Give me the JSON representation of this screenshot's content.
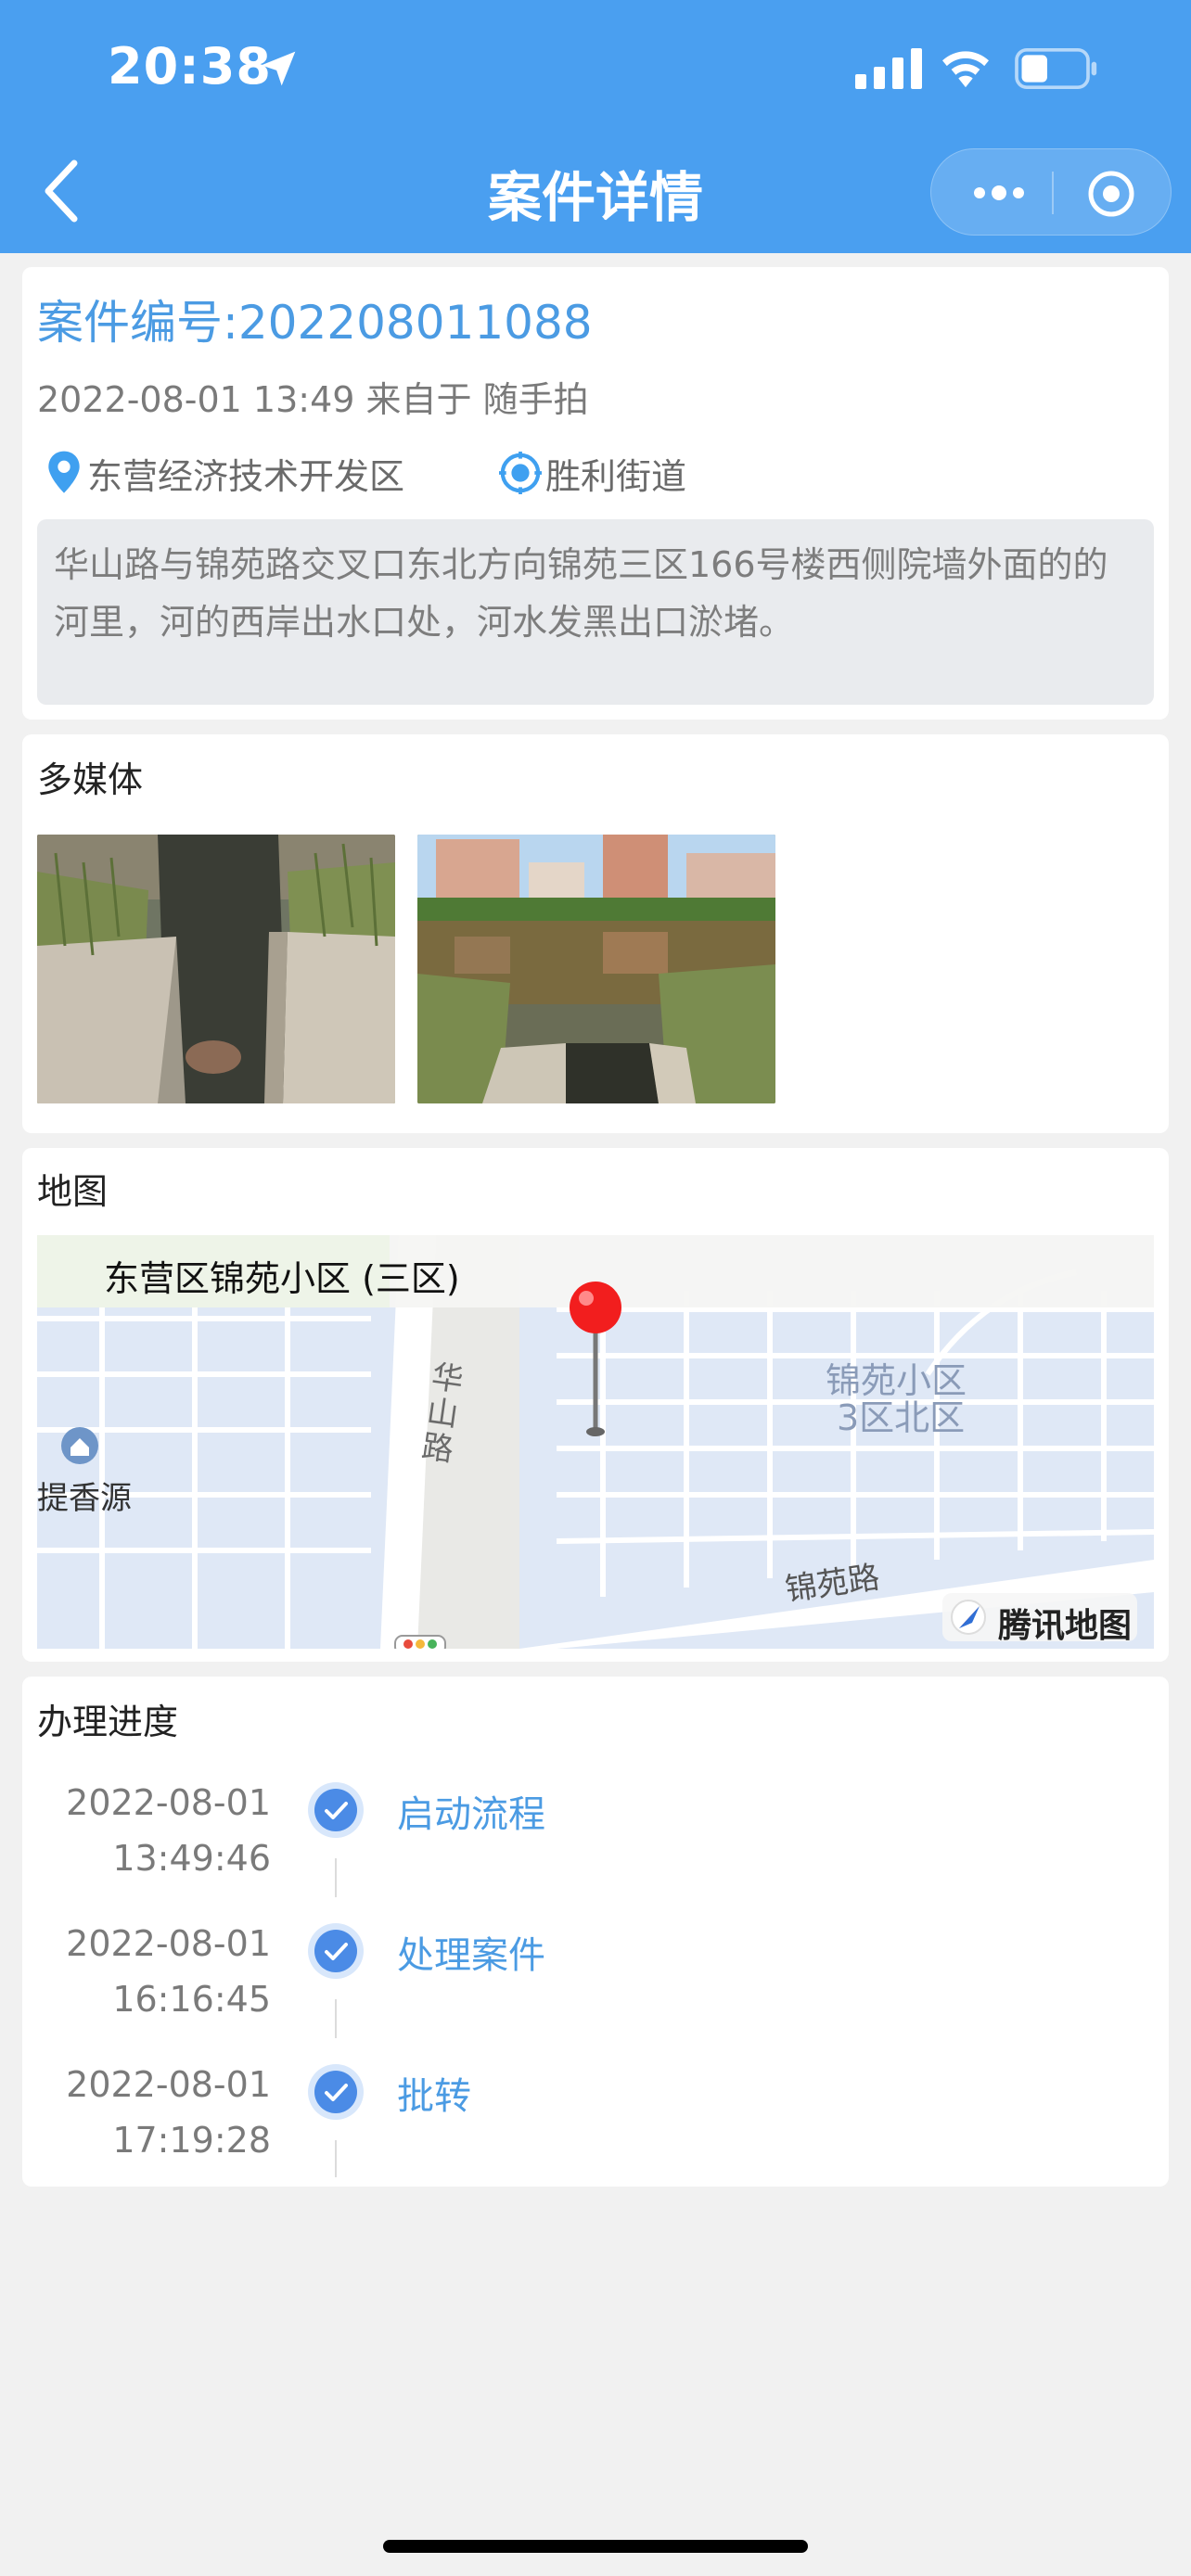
{
  "status_bar": {
    "time": "20:38"
  },
  "nav": {
    "title": "案件详情"
  },
  "case": {
    "number": "案件编号:202208011088",
    "meta": "2022-08-01 13:49 来自于 随手拍",
    "district": "东营经济技术开发区",
    "street": "胜利街道",
    "description": "华山路与锦苑路交叉口东北方向锦苑三区166号楼西侧院墙外面的的河里，河的西岸出水口处，河水发黑出口淤堵。"
  },
  "media": {
    "title": "多媒体"
  },
  "map": {
    "title": "地图",
    "place_name": "东营区锦苑小区 (三区)",
    "labels": {
      "huashan_road": "华山路",
      "jinyuan_road": "锦苑路",
      "community_line1": "锦苑小区",
      "community_line2": "3区北区",
      "poi": "提香源"
    },
    "provider": "腾讯地图"
  },
  "progress": {
    "title": "办理进度",
    "steps": [
      {
        "date": "2022-08-01",
        "time": "13:49:46",
        "label": "启动流程"
      },
      {
        "date": "2022-08-01",
        "time": "16:16:45",
        "label": "处理案件"
      },
      {
        "date": "2022-08-01",
        "time": "17:19:28",
        "label": "批转"
      }
    ]
  },
  "colors": {
    "header": "#4a9ff0",
    "accent": "#4b9be3",
    "background": "#f1f1f1"
  }
}
